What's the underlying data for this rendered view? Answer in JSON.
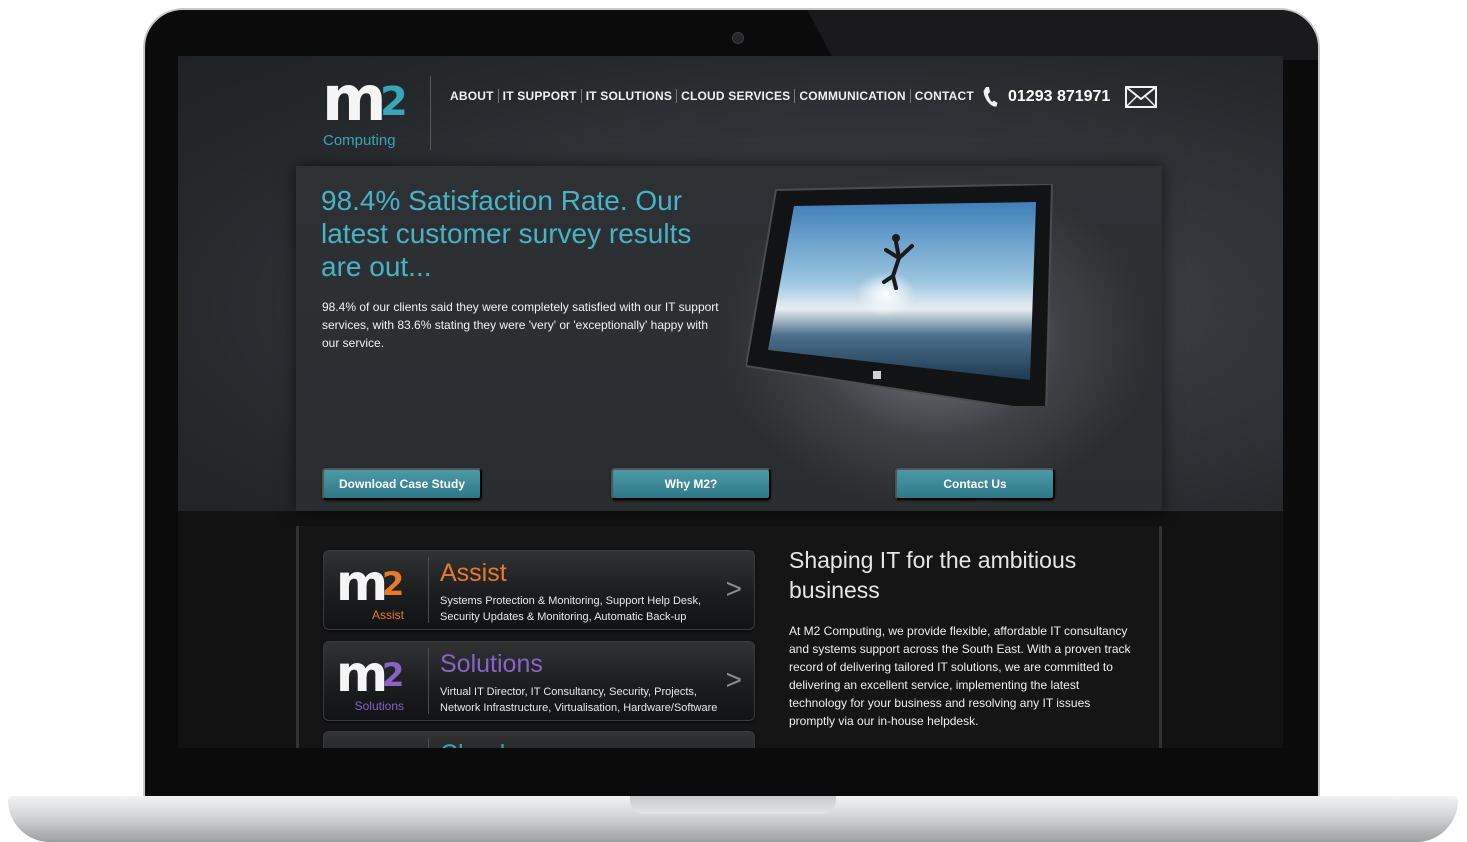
{
  "brand": {
    "logo_letter": "m",
    "logo_number": "2",
    "logo_sub": "Computing",
    "accent": "#48b3c4"
  },
  "nav": {
    "items": [
      "ABOUT",
      "IT SUPPORT",
      "IT SOLUTIONS",
      "CLOUD SERVICES",
      "COMMUNICATION",
      "CONTACT"
    ],
    "phone": "01293 871971"
  },
  "hero": {
    "headline": "98.4% Satisfaction Rate. Our latest customer survey results are out...",
    "body": "98.4% of our clients said they were completely satisfied with our IT support services, with 83.6% stating they were 'very' or 'exceptionally' happy with our service.",
    "buttons": [
      "Download Case Study",
      "Why M2?",
      "Contact Us"
    ]
  },
  "services": [
    {
      "logo_sub": "Assist",
      "title": "Assist",
      "color": "#e8792b",
      "desc": "Systems Protection & Monitoring, Support Help Desk, Security Updates & Monitoring, Automatic Back-up",
      "arrow": ">"
    },
    {
      "logo_sub": "Solutions",
      "title": "Solutions",
      "color": "#8a63c9",
      "desc": "Virtual IT Director, IT Consultancy, Security, Projects, Network Infrastructure, Virtualisation, Hardware/Software",
      "arrow": ">"
    },
    {
      "logo_sub": "",
      "title": "Cloud",
      "color": "#36a6b8",
      "desc": "",
      "arrow": ""
    }
  ],
  "about": {
    "title": "Shaping IT for the ambitious business",
    "body": "At M2 Computing, we provide flexible, affordable IT consultancy and systems support across the South East. With a proven track record of delivering tailored IT solutions, we are committed to delivering an excellent service, implementing the latest technology for your business and resolving any IT issues promptly via our in-house helpdesk."
  }
}
